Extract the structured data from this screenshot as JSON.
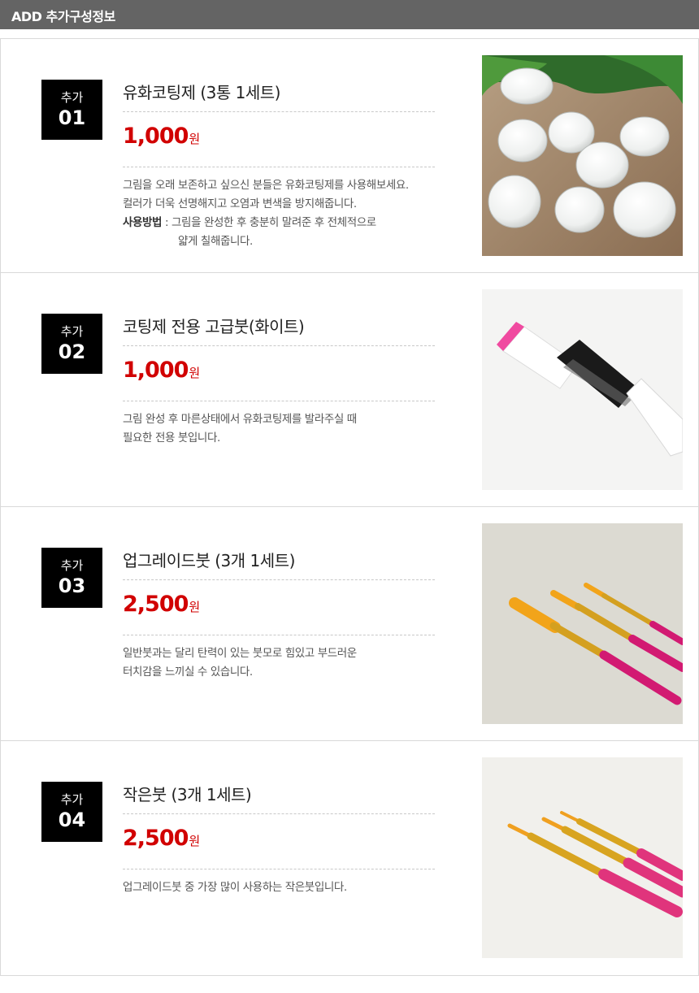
{
  "header": {
    "title": "ADD 추가구성정보"
  },
  "items": [
    {
      "badge_label": "추가",
      "badge_number": "01",
      "name": "유화코팅제 (3통 1세트)",
      "price": "1,000",
      "price_unit": "원",
      "desc_lines": [
        "그림을 오래 보존하고 싶으신 분들은 유화코팅제를 사용해보세요.",
        "컬러가 더욱 선명해지고 오염과 변색을 방지해줍니다."
      ],
      "usage_label": "사용방법",
      "usage_lines": [
        ": 그림을 완성한 후 충분히 말려준 후 전체적으로",
        "얇게 칠해줍니다."
      ],
      "image": "white-coating-jars"
    },
    {
      "badge_label": "추가",
      "badge_number": "02",
      "name": "코팅제 전용 고급붓(화이트)",
      "price": "1,000",
      "price_unit": "원",
      "desc_lines": [
        "그림 완성 후 마른상태에서 유화코팅제를 발라주실 때",
        "필요한 전용 붓입니다."
      ],
      "image": "white-flat-brush"
    },
    {
      "badge_label": "추가",
      "badge_number": "03",
      "name": "업그레이드붓 (3개 1세트)",
      "price": "2,500",
      "price_unit": "원",
      "desc_lines": [
        "일반붓과는 달리 탄력이 있는 붓모로 힘있고 부드러운",
        "터치감을 느끼실 수 있습니다."
      ],
      "image": "pink-gold-brushes"
    },
    {
      "badge_label": "추가",
      "badge_number": "04",
      "name": "작은붓 (3개 1세트)",
      "price": "2,500",
      "price_unit": "원",
      "desc_lines": [
        "업그레이드붓 중 가장 많이 사용하는 작은붓입니다."
      ],
      "image": "small-pink-brushes"
    }
  ]
}
